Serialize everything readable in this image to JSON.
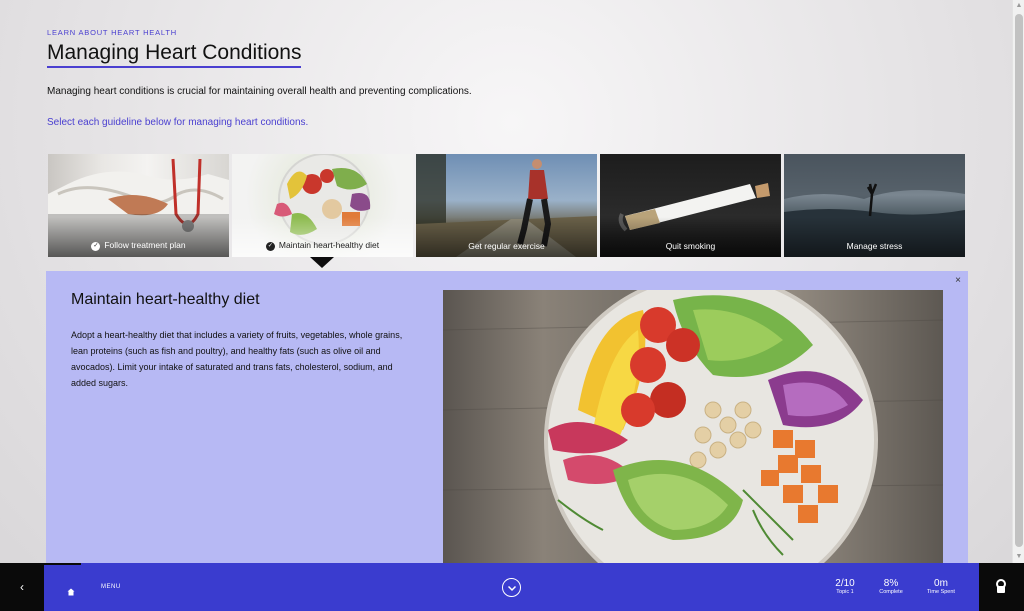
{
  "eyebrow": "LEARN ABOUT HEART HEALTH",
  "title": "Managing Heart Conditions",
  "intro": "Managing heart conditions is crucial for maintaining overall health and preventing complications.",
  "instruction": "Select each guideline below for managing heart conditions.",
  "tiles": [
    {
      "label": "Follow treatment plan",
      "visited": true
    },
    {
      "label": "Maintain heart-healthy diet",
      "visited": true
    },
    {
      "label": "Get regular exercise",
      "visited": false
    },
    {
      "label": "Quit smoking",
      "visited": false
    },
    {
      "label": "Manage stress",
      "visited": false
    }
  ],
  "detail": {
    "close": "×",
    "heading": "Maintain heart-healthy diet",
    "body": "Adopt a heart-healthy diet that includes a variety of fruits, vegetables, whole grains, lean proteins (such as fish and poultry), and healthy fats (such as olive oil and avocados). Limit your intake of saturated and trans fats, cholesterol, sodium, and added sugars."
  },
  "bottom_bar": {
    "back_icon": "‹",
    "menu_label": "MENU",
    "topic_value": "2/10",
    "topic_label": "Topic 1",
    "complete_value": "8%",
    "complete_label": "Complete",
    "time_value": "0m",
    "time_label": "Time Spent"
  },
  "colors": {
    "accent": "#4a3fd0",
    "panel": "#b7b9f4",
    "bar": "#3a3ccf"
  }
}
